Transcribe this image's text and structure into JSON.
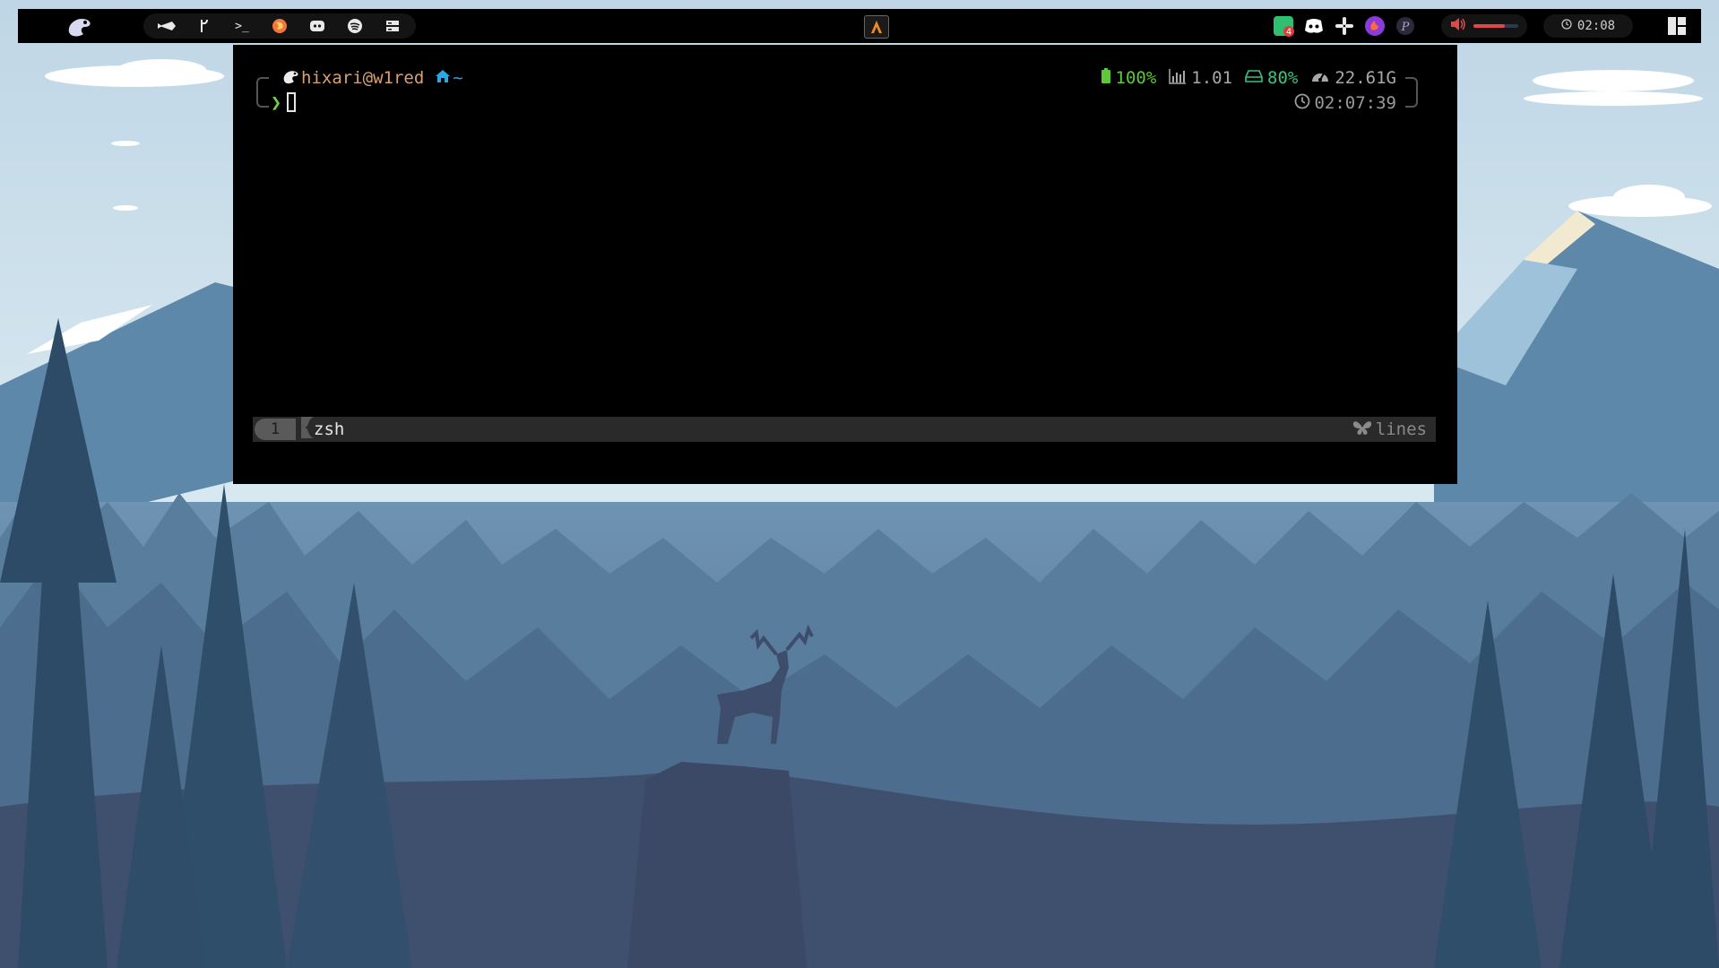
{
  "topbar": {
    "logo_icon": "gnome-foot-logo-icon",
    "launcher_apps": [
      {
        "name": "rocket-launcher-icon",
        "glyph": ""
      },
      {
        "name": "git-branch-icon",
        "glyph": "ᚹ"
      },
      {
        "name": "terminal-icon",
        "glyph": ">_"
      },
      {
        "name": "firefox-icon",
        "glyph": ""
      },
      {
        "name": "discord-icon",
        "glyph": ""
      },
      {
        "name": "spotify-icon",
        "glyph": ""
      },
      {
        "name": "files-icon",
        "glyph": ""
      }
    ],
    "active_window_icon": "alacritty-icon",
    "tray_icons": [
      {
        "name": "notification-app-icon",
        "badge": "4",
        "color": "#2fbf71"
      },
      {
        "name": "discord-tray-icon",
        "badge": "",
        "color": "#ffffff"
      },
      {
        "name": "slack-tray-icon",
        "badge": "",
        "color": "#e8e8e8"
      },
      {
        "name": "firefox-nightly-tray-icon",
        "badge": "",
        "color": "#8a3cd8"
      },
      {
        "name": "p-app-tray-icon",
        "badge": "",
        "color": "#8a8aa0"
      }
    ],
    "volume": {
      "icon": "speaker-icon",
      "level": 0.7,
      "color": "#e04848"
    },
    "clock": {
      "icon": "clock-icon",
      "time": "02:08"
    },
    "layout_icon": "window-layout-icon"
  },
  "terminal": {
    "user_host": "hixari@w1red",
    "dir": "~",
    "battery": "100%",
    "load": "1.01",
    "disk": "80%",
    "memory": "22.61G",
    "time": "02:07:39",
    "colors": {
      "battery": "#5fc83a",
      "load": "#a8a8a8",
      "disk": "#3ec080",
      "memory": "#a8a8a8",
      "user": "#d9a070",
      "dir": "#2aa8e0"
    },
    "tmux": {
      "window_index": "1",
      "window_name": "zsh",
      "status_right": "lines"
    }
  }
}
